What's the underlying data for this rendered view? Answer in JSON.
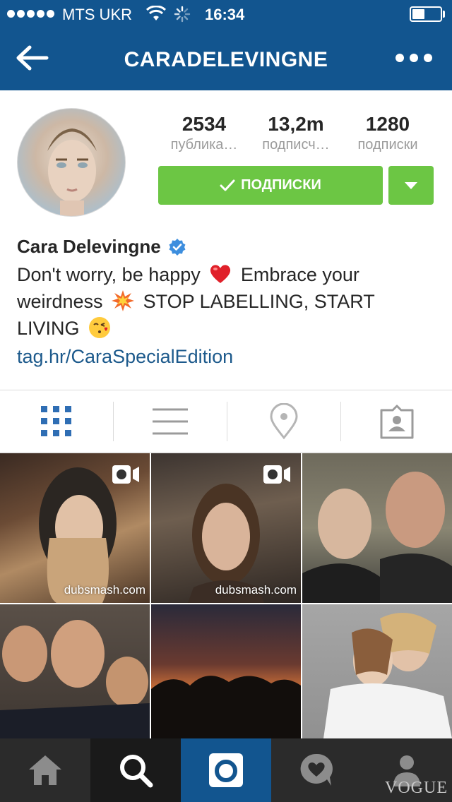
{
  "status_bar": {
    "carrier": "MTS UKR",
    "time": "16:34",
    "battery_level": 0.45
  },
  "nav": {
    "title": "CARADELEVINGNE"
  },
  "profile": {
    "stats": [
      {
        "value": "2534",
        "label": "публика…"
      },
      {
        "value": "13,2m",
        "label": "подписч…"
      },
      {
        "value": "1280",
        "label": "подписки"
      }
    ],
    "follow_label": "ПОДПИСКИ",
    "name": "Cara Delevingne",
    "bio_part1": "Don't worry, be happy",
    "bio_part2": "Embrace your weirdness",
    "bio_part3": "STOP LABELLING, START LIVING",
    "link": "tag.hr/CaraSpecialEdition"
  },
  "tabs": [
    {
      "name": "grid",
      "icon": "grid-icon",
      "active": true
    },
    {
      "name": "list",
      "icon": "list-icon",
      "active": false
    },
    {
      "name": "location",
      "icon": "location-pin-icon",
      "active": false
    },
    {
      "name": "tagged",
      "icon": "tagged-person-icon",
      "active": false
    }
  ],
  "posts": [
    {
      "type": "video",
      "watermark": "dubsmash.com"
    },
    {
      "type": "video",
      "watermark": "dubsmash.com"
    },
    {
      "type": "photo"
    },
    {
      "type": "photo"
    },
    {
      "type": "photo"
    },
    {
      "type": "photo"
    }
  ],
  "bottom_nav": [
    {
      "icon": "home-icon",
      "active": false
    },
    {
      "icon": "search-icon",
      "active": false
    },
    {
      "icon": "camera-icon",
      "active": true
    },
    {
      "icon": "activity-heart-icon",
      "active": false
    },
    {
      "icon": "profile-icon",
      "active": false
    }
  ],
  "watermark": "VOGUE",
  "colors": {
    "header": "#12558f",
    "follow_button": "#6cc644",
    "active_tab": "#2f6eb4",
    "link": "#1d5a8c",
    "bottom_bar": "#2b2b2b",
    "bottom_active": "#12558f"
  }
}
